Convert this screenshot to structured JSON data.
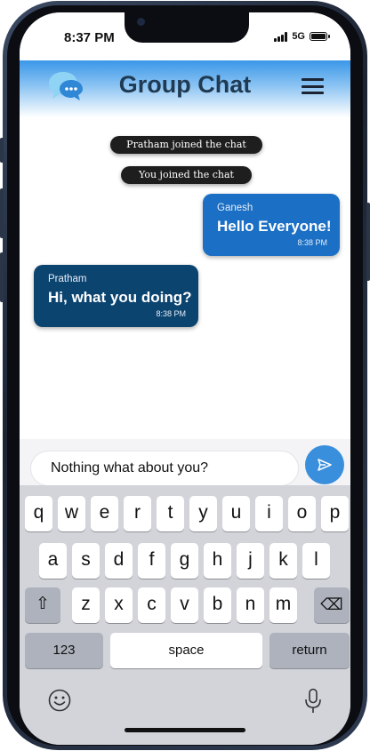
{
  "status_bar": {
    "time": "8:37 PM",
    "network": "5G"
  },
  "header": {
    "title": "Group Chat"
  },
  "notices": [
    "Pratham joined the chat",
    "You joined the chat"
  ],
  "messages": [
    {
      "sender": "Ganesh",
      "text": "Hello Everyone!",
      "time": "8:38 PM",
      "side": "right",
      "color": "#1b6fc4"
    },
    {
      "sender": "Pratham",
      "text": "Hi, what you doing?",
      "time": "8:38 PM",
      "side": "left",
      "color": "#0c4470"
    }
  ],
  "composer": {
    "value": "Nothing what about you?"
  },
  "keyboard": {
    "row1": [
      "q",
      "w",
      "e",
      "r",
      "t",
      "y",
      "u",
      "i",
      "o",
      "p"
    ],
    "row2": [
      "a",
      "s",
      "d",
      "f",
      "g",
      "h",
      "j",
      "k",
      "l"
    ],
    "row3": [
      "z",
      "x",
      "c",
      "v",
      "b",
      "n",
      "m"
    ],
    "numbers": "123",
    "space": "space",
    "return": "return",
    "shift_glyph": "⇧",
    "delete_glyph": "⌫"
  },
  "colors": {
    "accent": "#3a8fdc",
    "header": "#3a97e8",
    "title": "#1f3a52"
  }
}
